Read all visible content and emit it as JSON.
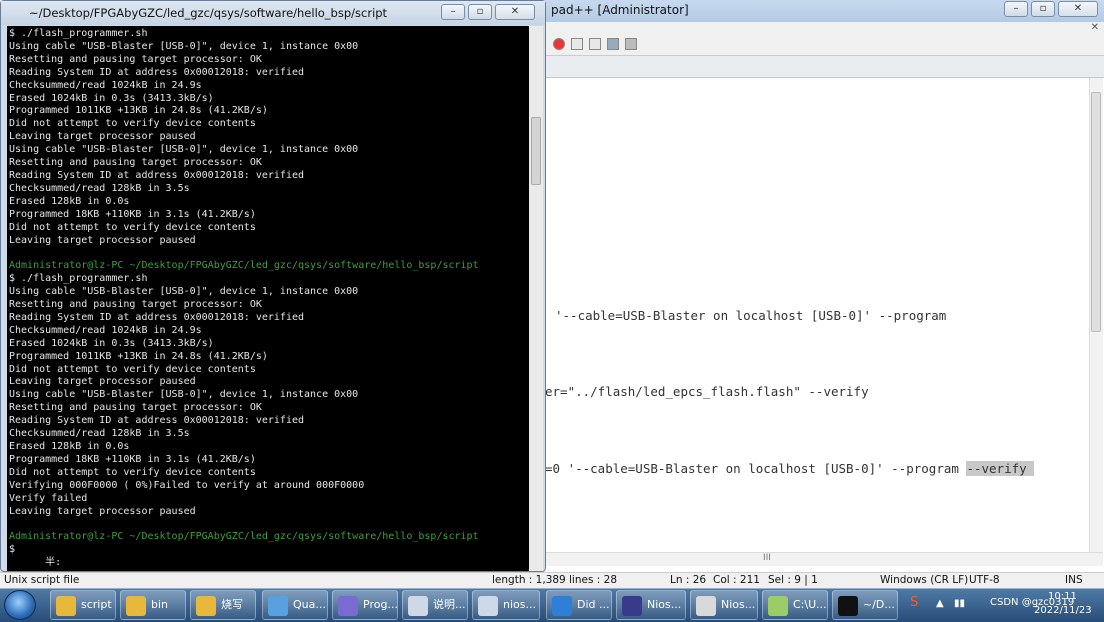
{
  "notepad": {
    "title": "pad++ [Administrator]",
    "subbar": "",
    "editor_lines": [
      {
        "pre": "'--cable=USB-Blaster on localhost [USB-0]' --program",
        "post": ""
      },
      {
        "pre": "er=\"../flash/led_epcs_flash.flash\" --verify",
        "post": ""
      },
      {
        "pre": "=0 '--cable=USB-Blaster on localhost [USB-0]' --program ",
        "post": "--verify "
      }
    ],
    "scroll_marker": "III"
  },
  "terminal": {
    "title": "~/Desktop/FPGAbyGZC/led_gzc/qsys/software/hello_bsp/script",
    "lines": [
      {
        "t": "$ ./flash_programmer.sh",
        "p": false
      },
      {
        "t": "Using cable \"USB-Blaster [USB-0]\", device 1, instance 0x00",
        "p": false
      },
      {
        "t": "Resetting and pausing target processor: OK",
        "p": false
      },
      {
        "t": "Reading System ID at address 0x00012018: verified",
        "p": false
      },
      {
        "t": "Checksummed/read 1024kB in 24.9s",
        "p": false
      },
      {
        "t": "Erased 1024kB in 0.3s (3413.3kB/s)",
        "p": false
      },
      {
        "t": "Programmed 1011KB +13KB in 24.8s (41.2KB/s)",
        "p": false
      },
      {
        "t": "Did not attempt to verify device contents",
        "p": false
      },
      {
        "t": "Leaving target processor paused",
        "p": false
      },
      {
        "t": "Using cable \"USB-Blaster [USB-0]\", device 1, instance 0x00",
        "p": false
      },
      {
        "t": "Resetting and pausing target processor: OK",
        "p": false
      },
      {
        "t": "Reading System ID at address 0x00012018: verified",
        "p": false
      },
      {
        "t": "Checksummed/read 128kB in 3.5s",
        "p": false
      },
      {
        "t": "Erased 128kB in 0.0s",
        "p": false
      },
      {
        "t": "Programmed 18KB +110KB in 3.1s (41.2KB/s)",
        "p": false
      },
      {
        "t": "Did not attempt to verify device contents",
        "p": false
      },
      {
        "t": "Leaving target processor paused",
        "p": false
      },
      {
        "t": "",
        "p": false
      },
      {
        "t": "Administrator@lz-PC ~/Desktop/FPGAbyGZC/led_gzc/qsys/software/hello_bsp/script",
        "p": true
      },
      {
        "t": "$ ./flash_programmer.sh",
        "p": false
      },
      {
        "t": "Using cable \"USB-Blaster [USB-0]\", device 1, instance 0x00",
        "p": false
      },
      {
        "t": "Resetting and pausing target processor: OK",
        "p": false
      },
      {
        "t": "Reading System ID at address 0x00012018: verified",
        "p": false
      },
      {
        "t": "Checksummed/read 1024kB in 24.9s",
        "p": false
      },
      {
        "t": "Erased 1024kB in 0.3s (3413.3kB/s)",
        "p": false
      },
      {
        "t": "Programmed 1011KB +13KB in 24.8s (41.2KB/s)",
        "p": false
      },
      {
        "t": "Did not attempt to verify device contents",
        "p": false
      },
      {
        "t": "Leaving target processor paused",
        "p": false
      },
      {
        "t": "Using cable \"USB-Blaster [USB-0]\", device 1, instance 0x00",
        "p": false
      },
      {
        "t": "Resetting and pausing target processor: OK",
        "p": false
      },
      {
        "t": "Reading System ID at address 0x00012018: verified",
        "p": false
      },
      {
        "t": "Checksummed/read 128kB in 3.5s",
        "p": false
      },
      {
        "t": "Erased 128kB in 0.0s",
        "p": false
      },
      {
        "t": "Programmed 18KB +110KB in 3.1s (41.2KB/s)",
        "p": false
      },
      {
        "t": "Did not attempt to verify device contents",
        "p": false
      },
      {
        "t": "Verifying 000F0000 ( 0%)Failed to verify at around 000F0000",
        "p": false
      },
      {
        "t": "Verify failed",
        "p": false
      },
      {
        "t": "Leaving target processor paused",
        "p": false
      },
      {
        "t": "",
        "p": false
      },
      {
        "t": "Administrator@lz-PC ~/Desktop/FPGAbyGZC/led_gzc/qsys/software/hello_bsp/script",
        "p": true
      },
      {
        "t": "$",
        "p": false
      },
      {
        "t": "      半:",
        "p": false
      }
    ]
  },
  "status": {
    "file_type": "Unix script file",
    "length": "length : 1,389",
    "lines": "lines : 28",
    "ln": "Ln : 26",
    "col": "Col : 211",
    "sel": "Sel : 9 | 1",
    "eol": "Windows (CR LF)",
    "encoding": "UTF-8",
    "mode": "INS"
  },
  "taskbar": {
    "items": [
      {
        "label": "script",
        "icon": "folder-icon",
        "color": "#e7b83c"
      },
      {
        "label": "bin",
        "icon": "folder-icon",
        "color": "#e7b83c"
      },
      {
        "label": "烧写",
        "icon": "folder-icon",
        "color": "#e7b83c"
      },
      {
        "label": "Qua...",
        "icon": "quartus-icon",
        "color": "#5aa0e0"
      },
      {
        "label": "Prog...",
        "icon": "programmer-icon",
        "color": "#7a6bd0"
      },
      {
        "label": "说明...",
        "icon": "document-icon",
        "color": "#cfd8e6"
      },
      {
        "label": "nios...",
        "icon": "document-icon",
        "color": "#cfd8e6"
      },
      {
        "label": "Did ...",
        "icon": "browser-icon",
        "color": "#2f7fd8"
      },
      {
        "label": "Nios...",
        "icon": "eclipse-icon",
        "color": "#3a3a8a"
      },
      {
        "label": "Nios...",
        "icon": "java-icon",
        "color": "#d9d9d9"
      },
      {
        "label": "C:\\U...",
        "icon": "notepadpp-icon",
        "color": "#9ccc65"
      },
      {
        "label": "~/D...",
        "icon": "terminal-icon",
        "color": "#111111"
      }
    ],
    "clock_time": "10:11",
    "clock_date": "2022/11/23",
    "watermark": "CSDN @gzc0319"
  },
  "colors": {
    "prompt": "#3aa03a",
    "terminal_bg": "#000000",
    "taskbar": "#274d77"
  }
}
